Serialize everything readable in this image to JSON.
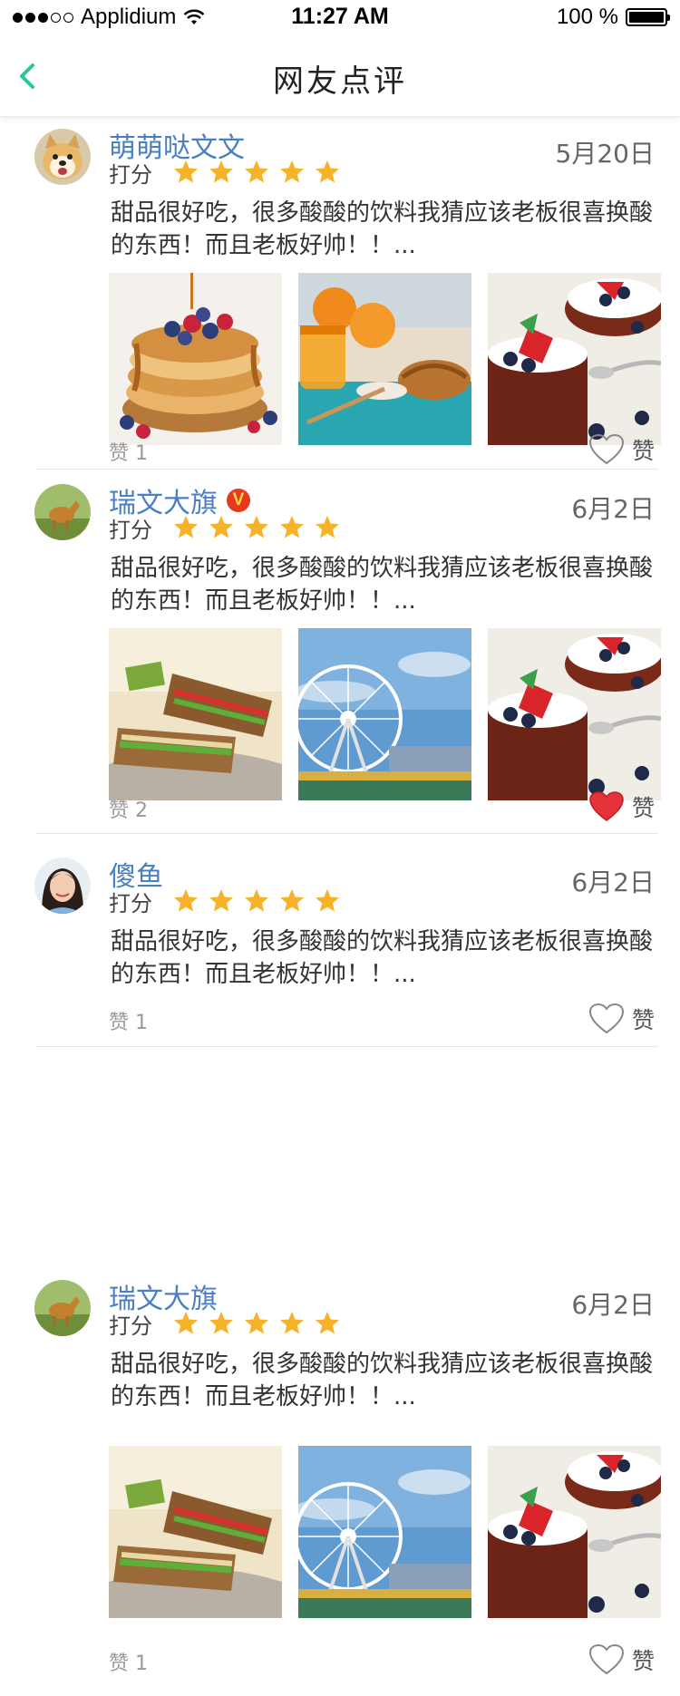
{
  "status_bar": {
    "carrier": "Applidium",
    "time": "11:27 AM",
    "battery": "100 %"
  },
  "nav": {
    "title": "网友点评"
  },
  "score_label": "打分",
  "like_label": "赞",
  "reviews": [
    {
      "user": "萌萌哒文文",
      "date": "5月20日",
      "rating": 5,
      "content": "甜品很好吃，很多酸酸的饮料我猜应该老板很喜换酸的东西！而且老板好帅！！...",
      "likes": "赞 1",
      "liked": false
    },
    {
      "user": "瑞文大旗",
      "badge": "V",
      "date": "6月2日",
      "rating": 5,
      "content": "甜品很好吃，很多酸酸的饮料我猜应该老板很喜换酸的东西！而且老板好帅！！...",
      "likes": "赞 2",
      "liked": true
    },
    {
      "user": "傻鱼",
      "date": "6月2日",
      "rating": 5,
      "content": "甜品很好吃，很多酸酸的饮料我猜应该老板很喜换酸的东西！而且老板好帅！！...",
      "likes": "赞 1",
      "liked": false
    },
    {
      "user": "瑞文大旗",
      "date": "6月2日",
      "rating": 5,
      "content": "甜品很好吃，很多酸酸的饮料我猜应该老板很喜换酸的东西！而且老板好帅！！...",
      "likes": "赞 1",
      "liked": false
    }
  ],
  "colors": {
    "accent": "#2bc69a",
    "username": "#4a7fc1",
    "star": "#f6b32a",
    "liked_heart": "#e5323a",
    "divider": "#e6e6e6"
  },
  "icons": {
    "back": "chevron-left-icon",
    "star": "star-icon",
    "like": "heart-icon",
    "verified": "verified-v-badge"
  }
}
